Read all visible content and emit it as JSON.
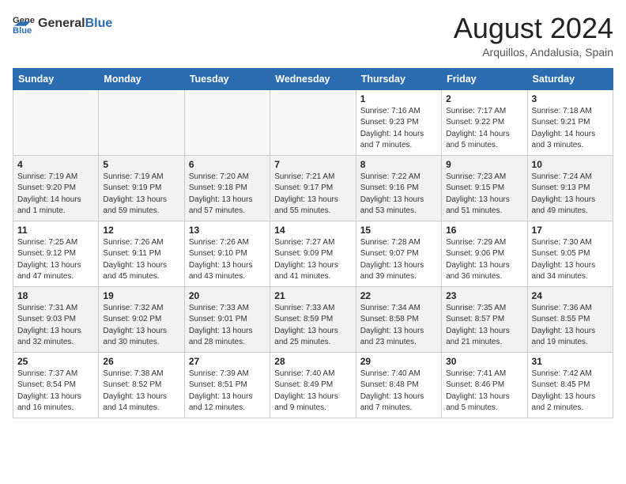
{
  "logo": {
    "text_general": "General",
    "text_blue": "Blue"
  },
  "title": "August 2024",
  "location": "Arquillos, Andalusia, Spain",
  "days_of_week": [
    "Sunday",
    "Monday",
    "Tuesday",
    "Wednesday",
    "Thursday",
    "Friday",
    "Saturday"
  ],
  "weeks": [
    [
      {
        "day": "",
        "info": ""
      },
      {
        "day": "",
        "info": ""
      },
      {
        "day": "",
        "info": ""
      },
      {
        "day": "",
        "info": ""
      },
      {
        "day": "1",
        "info": "Sunrise: 7:16 AM\nSunset: 9:23 PM\nDaylight: 14 hours and 7 minutes."
      },
      {
        "day": "2",
        "info": "Sunrise: 7:17 AM\nSunset: 9:22 PM\nDaylight: 14 hours and 5 minutes."
      },
      {
        "day": "3",
        "info": "Sunrise: 7:18 AM\nSunset: 9:21 PM\nDaylight: 14 hours and 3 minutes."
      }
    ],
    [
      {
        "day": "4",
        "info": "Sunrise: 7:19 AM\nSunset: 9:20 PM\nDaylight: 14 hours and 1 minute."
      },
      {
        "day": "5",
        "info": "Sunrise: 7:19 AM\nSunset: 9:19 PM\nDaylight: 13 hours and 59 minutes."
      },
      {
        "day": "6",
        "info": "Sunrise: 7:20 AM\nSunset: 9:18 PM\nDaylight: 13 hours and 57 minutes."
      },
      {
        "day": "7",
        "info": "Sunrise: 7:21 AM\nSunset: 9:17 PM\nDaylight: 13 hours and 55 minutes."
      },
      {
        "day": "8",
        "info": "Sunrise: 7:22 AM\nSunset: 9:16 PM\nDaylight: 13 hours and 53 minutes."
      },
      {
        "day": "9",
        "info": "Sunrise: 7:23 AM\nSunset: 9:15 PM\nDaylight: 13 hours and 51 minutes."
      },
      {
        "day": "10",
        "info": "Sunrise: 7:24 AM\nSunset: 9:13 PM\nDaylight: 13 hours and 49 minutes."
      }
    ],
    [
      {
        "day": "11",
        "info": "Sunrise: 7:25 AM\nSunset: 9:12 PM\nDaylight: 13 hours and 47 minutes."
      },
      {
        "day": "12",
        "info": "Sunrise: 7:26 AM\nSunset: 9:11 PM\nDaylight: 13 hours and 45 minutes."
      },
      {
        "day": "13",
        "info": "Sunrise: 7:26 AM\nSunset: 9:10 PM\nDaylight: 13 hours and 43 minutes."
      },
      {
        "day": "14",
        "info": "Sunrise: 7:27 AM\nSunset: 9:09 PM\nDaylight: 13 hours and 41 minutes."
      },
      {
        "day": "15",
        "info": "Sunrise: 7:28 AM\nSunset: 9:07 PM\nDaylight: 13 hours and 39 minutes."
      },
      {
        "day": "16",
        "info": "Sunrise: 7:29 AM\nSunset: 9:06 PM\nDaylight: 13 hours and 36 minutes."
      },
      {
        "day": "17",
        "info": "Sunrise: 7:30 AM\nSunset: 9:05 PM\nDaylight: 13 hours and 34 minutes."
      }
    ],
    [
      {
        "day": "18",
        "info": "Sunrise: 7:31 AM\nSunset: 9:03 PM\nDaylight: 13 hours and 32 minutes."
      },
      {
        "day": "19",
        "info": "Sunrise: 7:32 AM\nSunset: 9:02 PM\nDaylight: 13 hours and 30 minutes."
      },
      {
        "day": "20",
        "info": "Sunrise: 7:33 AM\nSunset: 9:01 PM\nDaylight: 13 hours and 28 minutes."
      },
      {
        "day": "21",
        "info": "Sunrise: 7:33 AM\nSunset: 8:59 PM\nDaylight: 13 hours and 25 minutes."
      },
      {
        "day": "22",
        "info": "Sunrise: 7:34 AM\nSunset: 8:58 PM\nDaylight: 13 hours and 23 minutes."
      },
      {
        "day": "23",
        "info": "Sunrise: 7:35 AM\nSunset: 8:57 PM\nDaylight: 13 hours and 21 minutes."
      },
      {
        "day": "24",
        "info": "Sunrise: 7:36 AM\nSunset: 8:55 PM\nDaylight: 13 hours and 19 minutes."
      }
    ],
    [
      {
        "day": "25",
        "info": "Sunrise: 7:37 AM\nSunset: 8:54 PM\nDaylight: 13 hours and 16 minutes."
      },
      {
        "day": "26",
        "info": "Sunrise: 7:38 AM\nSunset: 8:52 PM\nDaylight: 13 hours and 14 minutes."
      },
      {
        "day": "27",
        "info": "Sunrise: 7:39 AM\nSunset: 8:51 PM\nDaylight: 13 hours and 12 minutes."
      },
      {
        "day": "28",
        "info": "Sunrise: 7:40 AM\nSunset: 8:49 PM\nDaylight: 13 hours and 9 minutes."
      },
      {
        "day": "29",
        "info": "Sunrise: 7:40 AM\nSunset: 8:48 PM\nDaylight: 13 hours and 7 minutes."
      },
      {
        "day": "30",
        "info": "Sunrise: 7:41 AM\nSunset: 8:46 PM\nDaylight: 13 hours and 5 minutes."
      },
      {
        "day": "31",
        "info": "Sunrise: 7:42 AM\nSunset: 8:45 PM\nDaylight: 13 hours and 2 minutes."
      }
    ]
  ]
}
